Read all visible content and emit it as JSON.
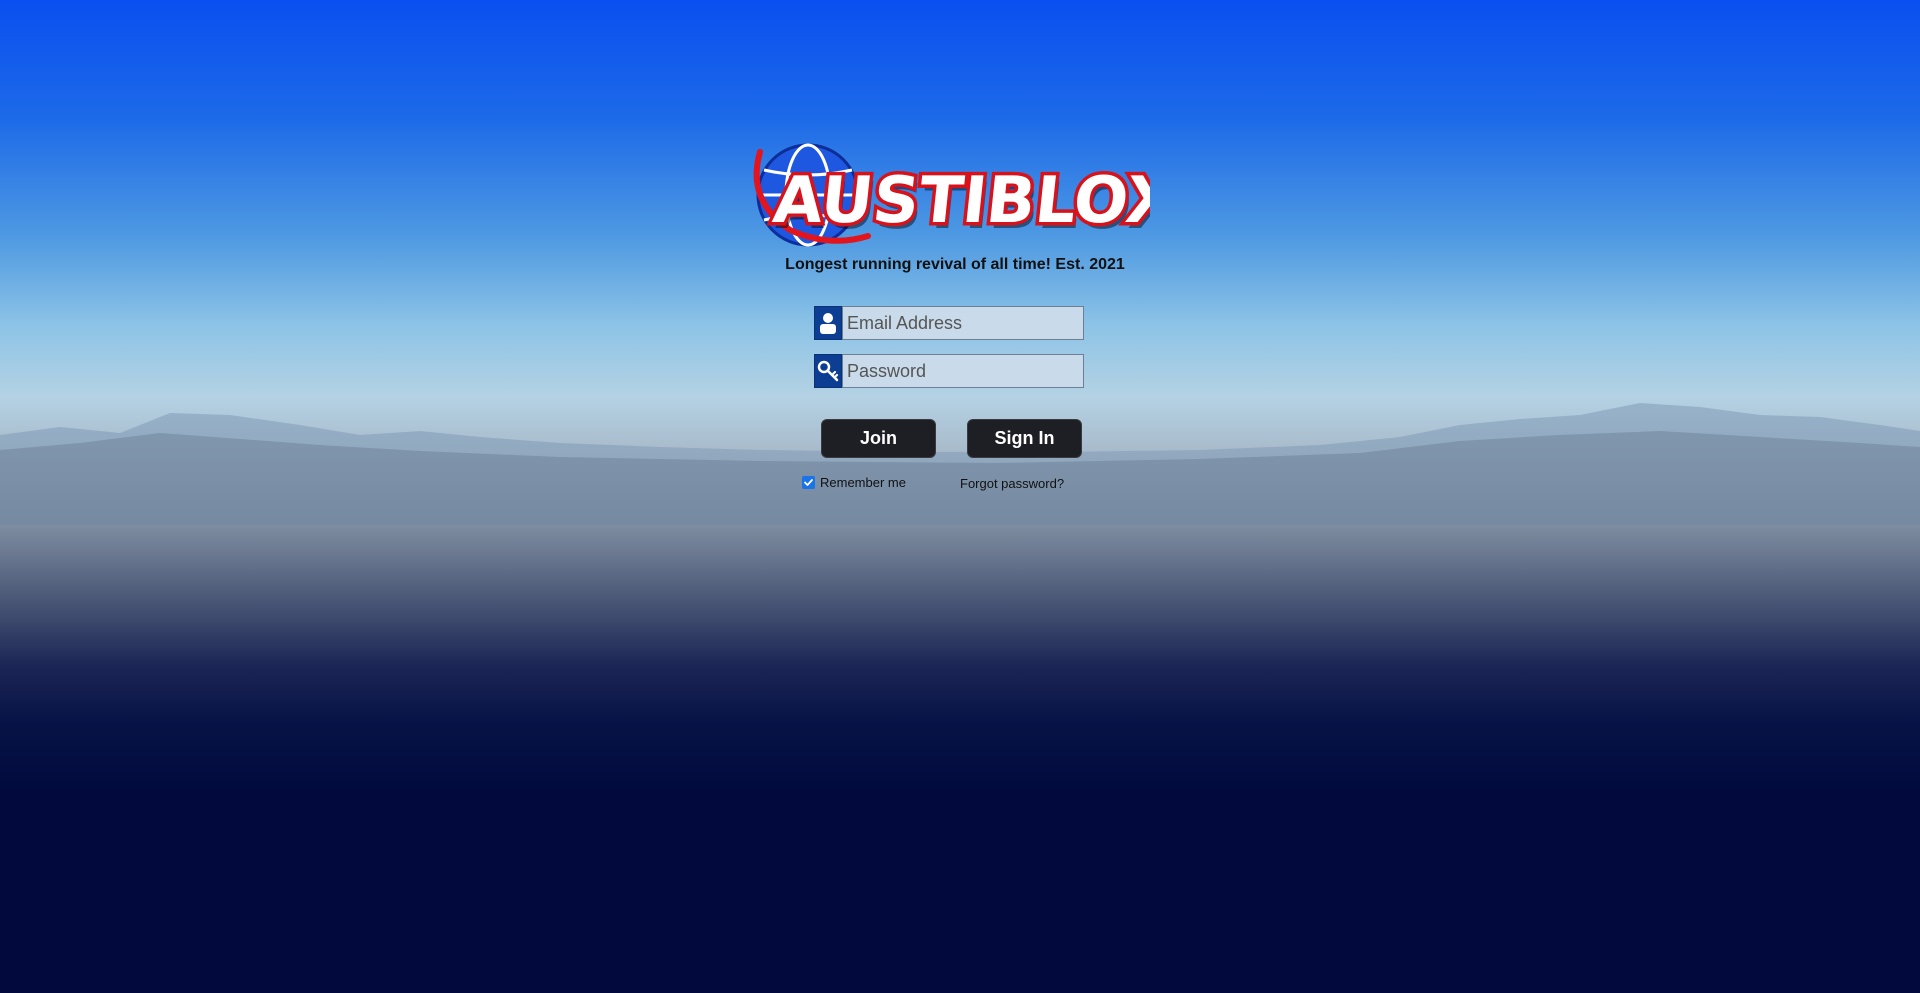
{
  "brand": {
    "logo_text": "AUSTIBLOX",
    "tagline": "Longest running revival of all time! Est. 2021",
    "colors": {
      "logo_red": "#d8121b",
      "logo_white": "#ffffff",
      "globe_blue": "#1f58e0"
    }
  },
  "login": {
    "email_placeholder": "Email Address",
    "email_value": "",
    "email_icon": "user-icon",
    "password_placeholder": "Password",
    "password_value": "",
    "password_icon": "key-icon",
    "join_label": "Join",
    "signin_label": "Sign In",
    "remember_label": "Remember me",
    "remember_checked": true,
    "forgot_label": "Forgot password?"
  },
  "theme": {
    "sky_top": "#0a4ff0",
    "horizon": "#b4d2e4",
    "ground": "#020a3d",
    "button_bg": "#1e1f24",
    "icon_bg": "#0c3f93",
    "input_bg": "#c9dbea"
  }
}
